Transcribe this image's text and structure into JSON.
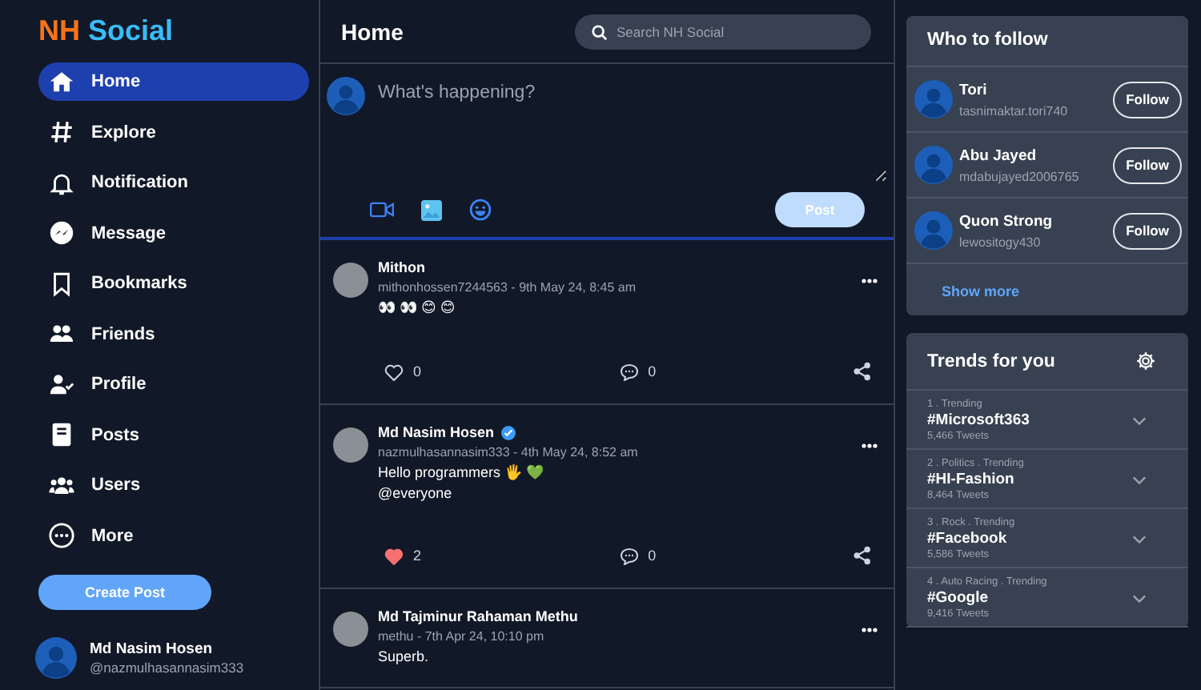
{
  "logo": {
    "first": "NH",
    "second": "Social"
  },
  "nav": [
    {
      "label": "Home",
      "selected": true
    },
    {
      "label": "Explore",
      "selected": false
    },
    {
      "label": "Notification",
      "selected": false
    },
    {
      "label": "Message",
      "selected": false
    },
    {
      "label": "Bookmarks",
      "selected": false
    },
    {
      "label": "Friends",
      "selected": false
    },
    {
      "label": "Profile",
      "selected": false
    },
    {
      "label": "Posts",
      "selected": false
    },
    {
      "label": "Users",
      "selected": false
    },
    {
      "label": "More",
      "selected": false
    }
  ],
  "create_post": "Create Post",
  "current_user": {
    "name": "Md Nasim Hosen",
    "handle": "@nazmulhasannasim333"
  },
  "header": {
    "title": "Home",
    "search_placeholder": "Search NH Social"
  },
  "composer": {
    "placeholder": "What's happening?",
    "post_button": "Post"
  },
  "posts": [
    {
      "name": "Mithon",
      "verified": false,
      "meta": "mithonhossen7244563 - 9th May 24, 8:45 am",
      "lines": [
        "👀 👀 😊 😊"
      ],
      "liked": false,
      "likes": "0",
      "comments": "0"
    },
    {
      "name": "Md Nasim Hosen",
      "verified": true,
      "meta": "nazmulhasannasim333 - 4th May 24, 8:52 am",
      "lines": [
        "Hello programmers 🖐 💚",
        "@everyone"
      ],
      "liked": true,
      "likes": "2",
      "comments": "0"
    },
    {
      "name": "Md Tajminur Rahaman Methu",
      "verified": false,
      "meta": "methu - 7th Apr 24, 10:10 pm",
      "lines": [
        "Superb."
      ]
    }
  ],
  "who_to_follow": {
    "title": "Who to follow",
    "users": [
      {
        "name": "Tori",
        "handle": "tasnimaktar.tori740",
        "button": "Follow"
      },
      {
        "name": "Abu Jayed",
        "handle": "mdabujayed2006765",
        "button": "Follow"
      },
      {
        "name": "Quon Strong",
        "handle": "lewositogy430",
        "button": "Follow"
      }
    ],
    "show_more": "Show more"
  },
  "trends": {
    "title": "Trends for you",
    "items": [
      {
        "context": "1 . Trending",
        "tag": "#Microsoft363",
        "count": "5,466 Tweets"
      },
      {
        "context": "2 . Politics . Trending",
        "tag": "#HI-Fashion",
        "count": "8,464 Tweets"
      },
      {
        "context": "3 . Rock . Trending",
        "tag": "#Facebook",
        "count": "5,586 Tweets"
      },
      {
        "context": "4 . Auto Racing . Trending",
        "tag": "#Google",
        "count": "9,416 Tweets"
      }
    ]
  }
}
